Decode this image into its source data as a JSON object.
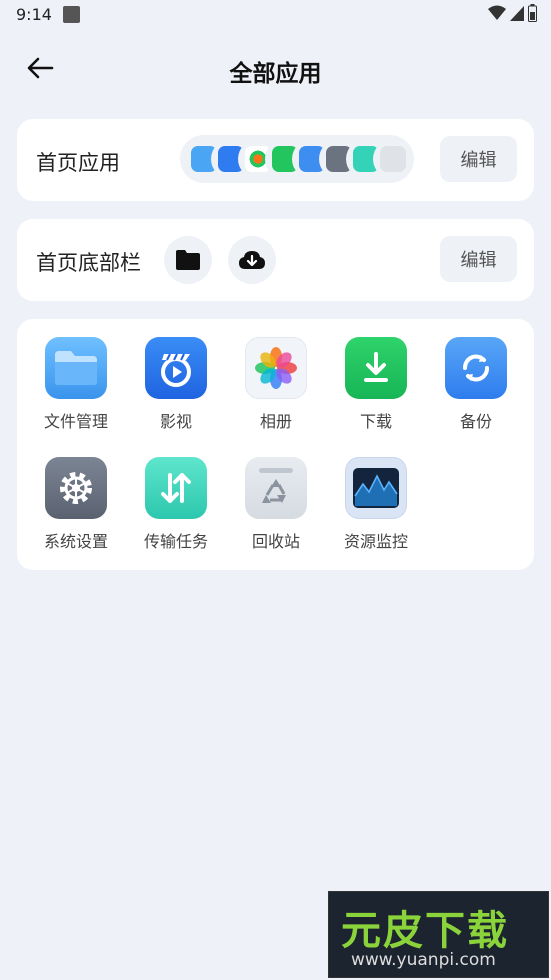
{
  "status_bar": {
    "time": "9:14"
  },
  "header": {
    "title": "全部应用"
  },
  "home_apps": {
    "label": "首页应用",
    "edit_label": "编辑"
  },
  "bottom_bar": {
    "label": "首页底部栏",
    "edit_label": "编辑"
  },
  "apps": [
    {
      "label": "文件管理",
      "icon": "folder-icon",
      "color": "#4aa6f4"
    },
    {
      "label": "影视",
      "icon": "film-play-icon",
      "color": "#2f7cf0"
    },
    {
      "label": "相册",
      "icon": "photo-flower-icon",
      "color": "#f4f6fa"
    },
    {
      "label": "下载",
      "icon": "download-icon",
      "color": "#22c55e"
    },
    {
      "label": "备份",
      "icon": "sync-icon",
      "color": "#3d8ef0"
    },
    {
      "label": "系统设置",
      "icon": "gear-icon",
      "color": "#6b7280"
    },
    {
      "label": "传输任务",
      "icon": "transfer-icon",
      "color": "#34d3b8"
    },
    {
      "label": "回收站",
      "icon": "recycle-icon",
      "color": "#e5e9ee"
    },
    {
      "label": "资源监控",
      "icon": "monitor-chart-icon",
      "color": "#1f3a5a"
    }
  ],
  "watermark": {
    "logo": "元皮下载",
    "url": "www.yuanpi.com"
  }
}
